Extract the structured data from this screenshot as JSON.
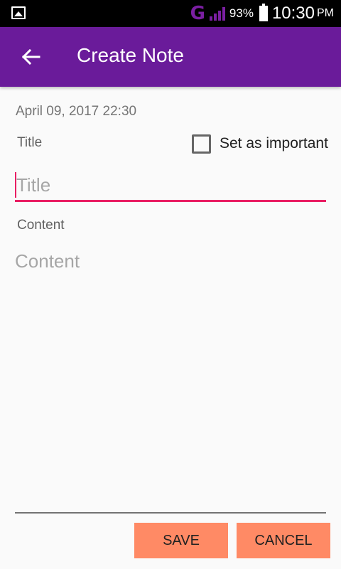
{
  "status_bar": {
    "network": "G",
    "battery_percent": "93%",
    "time": "10:30",
    "ampm": "PM"
  },
  "app_bar": {
    "back_icon": "arrow-left",
    "title": "Create Note"
  },
  "form": {
    "date": "April 09, 2017 22:30",
    "title_label": "Title",
    "important_label": "Set as important",
    "important_checked": false,
    "title_placeholder": "Title",
    "title_value": "",
    "content_label": "Content",
    "content_placeholder": "Content",
    "content_value": ""
  },
  "actions": {
    "save_label": "SAVE",
    "cancel_label": "CANCEL"
  },
  "colors": {
    "app_bar": "#6a1b9a",
    "accent": "#e91e63",
    "button": "#ff8a65",
    "network": "#7b1fa2"
  }
}
